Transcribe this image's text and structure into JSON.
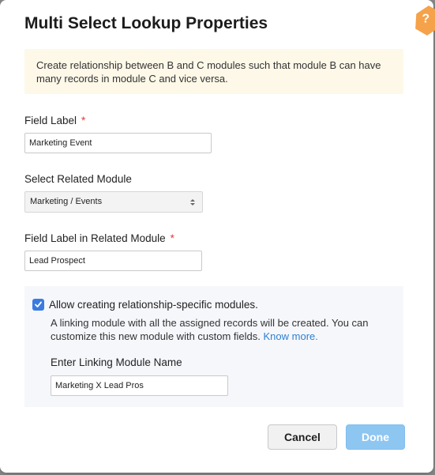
{
  "dialog": {
    "title": "Multi Select Lookup Properties",
    "info_text": "Create relationship between B and C modules such that module B can have many records in module C and vice versa."
  },
  "fields": {
    "field_label": {
      "label": "Field Label",
      "required_mark": "*",
      "value": "Marketing Event"
    },
    "related_module": {
      "label": "Select Related Module",
      "value": "Marketing / Events"
    },
    "related_field_label": {
      "label": "Field Label in Related Module",
      "required_mark": "*",
      "value": "Lead Prospect"
    }
  },
  "relationship": {
    "checked": true,
    "checkbox_label": "Allow creating relationship-specific modules.",
    "description": "A linking module with all the assigned records will be created. You can customize this new module with custom fields.",
    "know_more": "Know more.",
    "linking_label": "Enter Linking Module Name",
    "linking_value": "Marketing X Lead Pros"
  },
  "buttons": {
    "cancel": "Cancel",
    "done": "Done"
  },
  "badge": {
    "text": "?",
    "icon": "help-badge-icon"
  },
  "colors": {
    "accent": "#3a7be0",
    "done_button": "#8ec6f2",
    "info_background": "#fdf8e8",
    "required": "#e03a3a",
    "link": "#2d7fd1"
  }
}
